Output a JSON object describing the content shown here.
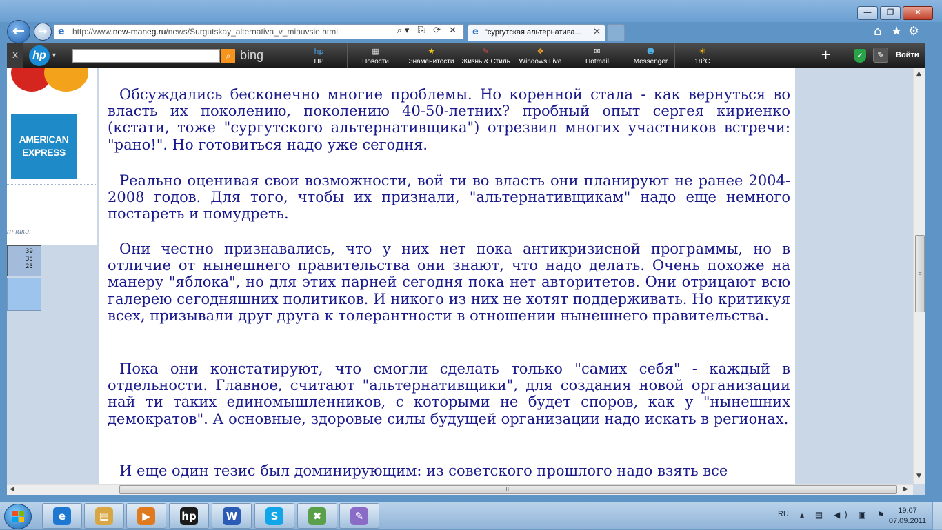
{
  "window": {
    "controls": {
      "minimize": "—",
      "maximize": "❐",
      "close": "✕"
    }
  },
  "nav": {
    "back_icon": "←",
    "forward_icon": "→",
    "url_prefix": "http://www.",
    "url_domain": "new-maneg.ru",
    "url_path": "/news/Surgutskay_alternativa_v_minuvsie.html",
    "address_tools": "⌕▾ ⎘ ⟳ ✕",
    "tab_title": "\"сургутская альтернатива...",
    "tab_close": "✕",
    "home_icon": "⌂",
    "star_icon": "★",
    "gear_icon": "⚙"
  },
  "hp_toolbar": {
    "close": "x",
    "logo": "hp",
    "search_placeholder": "",
    "search_go": "⌕",
    "bing_label": "bing",
    "items": [
      {
        "label": "HP",
        "icon": "hp",
        "icon_color": "#4aa3e8"
      },
      {
        "label": "Новости",
        "icon": "▦",
        "icon_color": "#dddddd"
      },
      {
        "label": "Знаменитости",
        "icon": "★",
        "icon_color": "#f5c518"
      },
      {
        "label": "Жизнь & Стиль",
        "icon": "✎",
        "icon_color": "#e04848"
      },
      {
        "label": "Windows Live",
        "icon": "❖",
        "icon_color": "#f6a32b"
      },
      {
        "label": "Hotmail",
        "icon": "✉",
        "icon_color": "#eeeeee"
      },
      {
        "label": "Messenger",
        "icon": "☻",
        "icon_color": "#4fb3e8"
      },
      {
        "label": "18°C",
        "icon": "☀",
        "icon_color": "#f5b700"
      }
    ],
    "plus": "+",
    "shield_icon": "✓",
    "wrench_icon": "✎",
    "login": "Войти"
  },
  "sidebar": {
    "amex_logo": "AMERICAN EXPRESS",
    "counters_label": "тчики:",
    "counter_values": [
      "39",
      "35",
      "23"
    ]
  },
  "article": {
    "paragraphs": [
      "Обсуждались бесконечно многие проблемы. Но коренной  стала - как вернуться во власть их поколению, поколению 40-50-летних? пробный  опыт сергея кириенко (кстати, тоже \"сургутского альтернативщика\") отрезвил многих участников встречи: \"рано!\". Но готовиться надо уже сегодня.",
      "Реально оценивая свои возможности, вой ти во власть они планируют не ранее 2004-2008 годов. Для того, чтобы их признали, \"альтернативщикам\" надо еще немного постареть и помудреть.",
      "Они честно признавались, что у них нет пока антикризисной  программы, но в отличие от нынешнего правительства они знают, что надо делать. Очень похоже на манеру \"яблока\", но для этих парней  сегодня пока нет авторитетов. Они отрицают всю галерею сегодняшних политиков. И никого из них не хотят поддерживать. Но критикуя всех, призывали друг друга к толерантности в отношении нынешнего правительства.",
      "Пока они констатируют, что смогли сделать только \"самих себя\" - каждый  в отдельности. Главное, считают \"альтернативщики\", для создания новой  организации най ти таких единомышленников, с которыми не будет споров, как у \"нынешних демократов\". А основные, здоровые силы будущей  организации надо искать в регионах.",
      "И еще один тезис был доминирующим: из советского прошлого надо взять все"
    ]
  },
  "scrollbars": {
    "up": "▲",
    "down": "▼",
    "left": "◀",
    "right": "▶",
    "grip_v": "≡",
    "grip_h": "III"
  },
  "taskbar": {
    "apps": [
      {
        "name": "internet-explorer",
        "icon": "e",
        "color": "#1e78d2"
      },
      {
        "name": "windows-explorer",
        "icon": "▤",
        "color": "#d8a642"
      },
      {
        "name": "media-player",
        "icon": "▶",
        "color": "#e07a1f"
      },
      {
        "name": "hp-app",
        "icon": "hp",
        "color": "#1b1b1b"
      },
      {
        "name": "word",
        "icon": "W",
        "color": "#2a5bb5"
      },
      {
        "name": "skype",
        "icon": "S",
        "color": "#12a5e8"
      },
      {
        "name": "network-tool",
        "icon": "✖",
        "color": "#5aa04a"
      },
      {
        "name": "paint",
        "icon": "✎",
        "color": "#8a6cc7"
      }
    ],
    "language": "RU",
    "tray_icons": "▴ ▤ ◀) ▣ ⚑",
    "time": "19:07",
    "date": "07.09.2011"
  }
}
